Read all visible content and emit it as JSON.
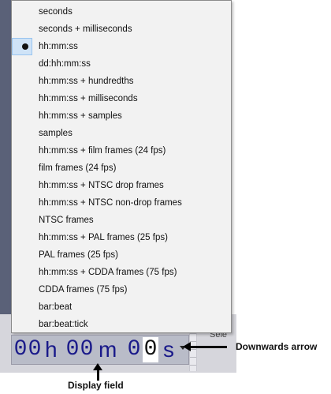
{
  "menu": {
    "items": [
      {
        "label": "seconds"
      },
      {
        "label": "seconds + milliseconds"
      },
      {
        "label": "hh:mm:ss",
        "selected": true
      },
      {
        "label": "dd:hh:mm:ss"
      },
      {
        "label": "hh:mm:ss + hundredths"
      },
      {
        "label": "hh:mm:ss + milliseconds"
      },
      {
        "label": "hh:mm:ss + samples"
      },
      {
        "label": "samples"
      },
      {
        "label": "hh:mm:ss + film frames (24 fps)"
      },
      {
        "label": "film frames (24 fps)"
      },
      {
        "label": "hh:mm:ss + NTSC drop frames"
      },
      {
        "label": "hh:mm:ss + NTSC non-drop frames"
      },
      {
        "label": "NTSC frames"
      },
      {
        "label": "hh:mm:ss + PAL frames (25 fps)"
      },
      {
        "label": "PAL frames (25 fps)"
      },
      {
        "label": "hh:mm:ss + CDDA frames (75 fps)"
      },
      {
        "label": "CDDA frames (75 fps)"
      },
      {
        "label": "bar:beat"
      },
      {
        "label": "bar:beat:tick"
      }
    ]
  },
  "display": {
    "h_tens": "0",
    "h_units": "0",
    "h_label": "h",
    "m_tens": "0",
    "m_units": "0",
    "m_label": "m",
    "s_tens": "0",
    "s_units": "0",
    "s_label": "s"
  },
  "background": {
    "partial_label": "Sele"
  },
  "annotations": {
    "arrow_label": "Downwards arrow",
    "field_label": "Display field"
  }
}
